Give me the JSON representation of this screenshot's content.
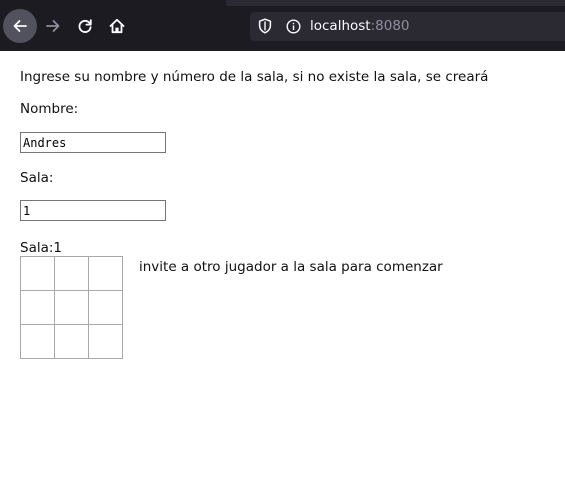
{
  "browser": {
    "url_host": "localhost",
    "url_port": ":8080",
    "icons": {
      "back": "arrow-left-icon",
      "forward": "arrow-right-icon",
      "reload": "reload-icon",
      "home": "home-icon",
      "tracking_protection": "shield-icon",
      "site_info": "info-icon"
    }
  },
  "page": {
    "instructions": "Ingrese su nombre y número de la sala, si no existe la sala, se creará",
    "name_label": "Nombre:",
    "name_value": "Andres",
    "room_label": "Sala:",
    "room_value": "1",
    "room_display": "Sala:1",
    "status": "invite a otro jugador a la sala para comenzar",
    "board": [
      [
        "",
        "",
        ""
      ],
      [
        "",
        "",
        ""
      ],
      [
        "",
        "",
        ""
      ]
    ]
  }
}
